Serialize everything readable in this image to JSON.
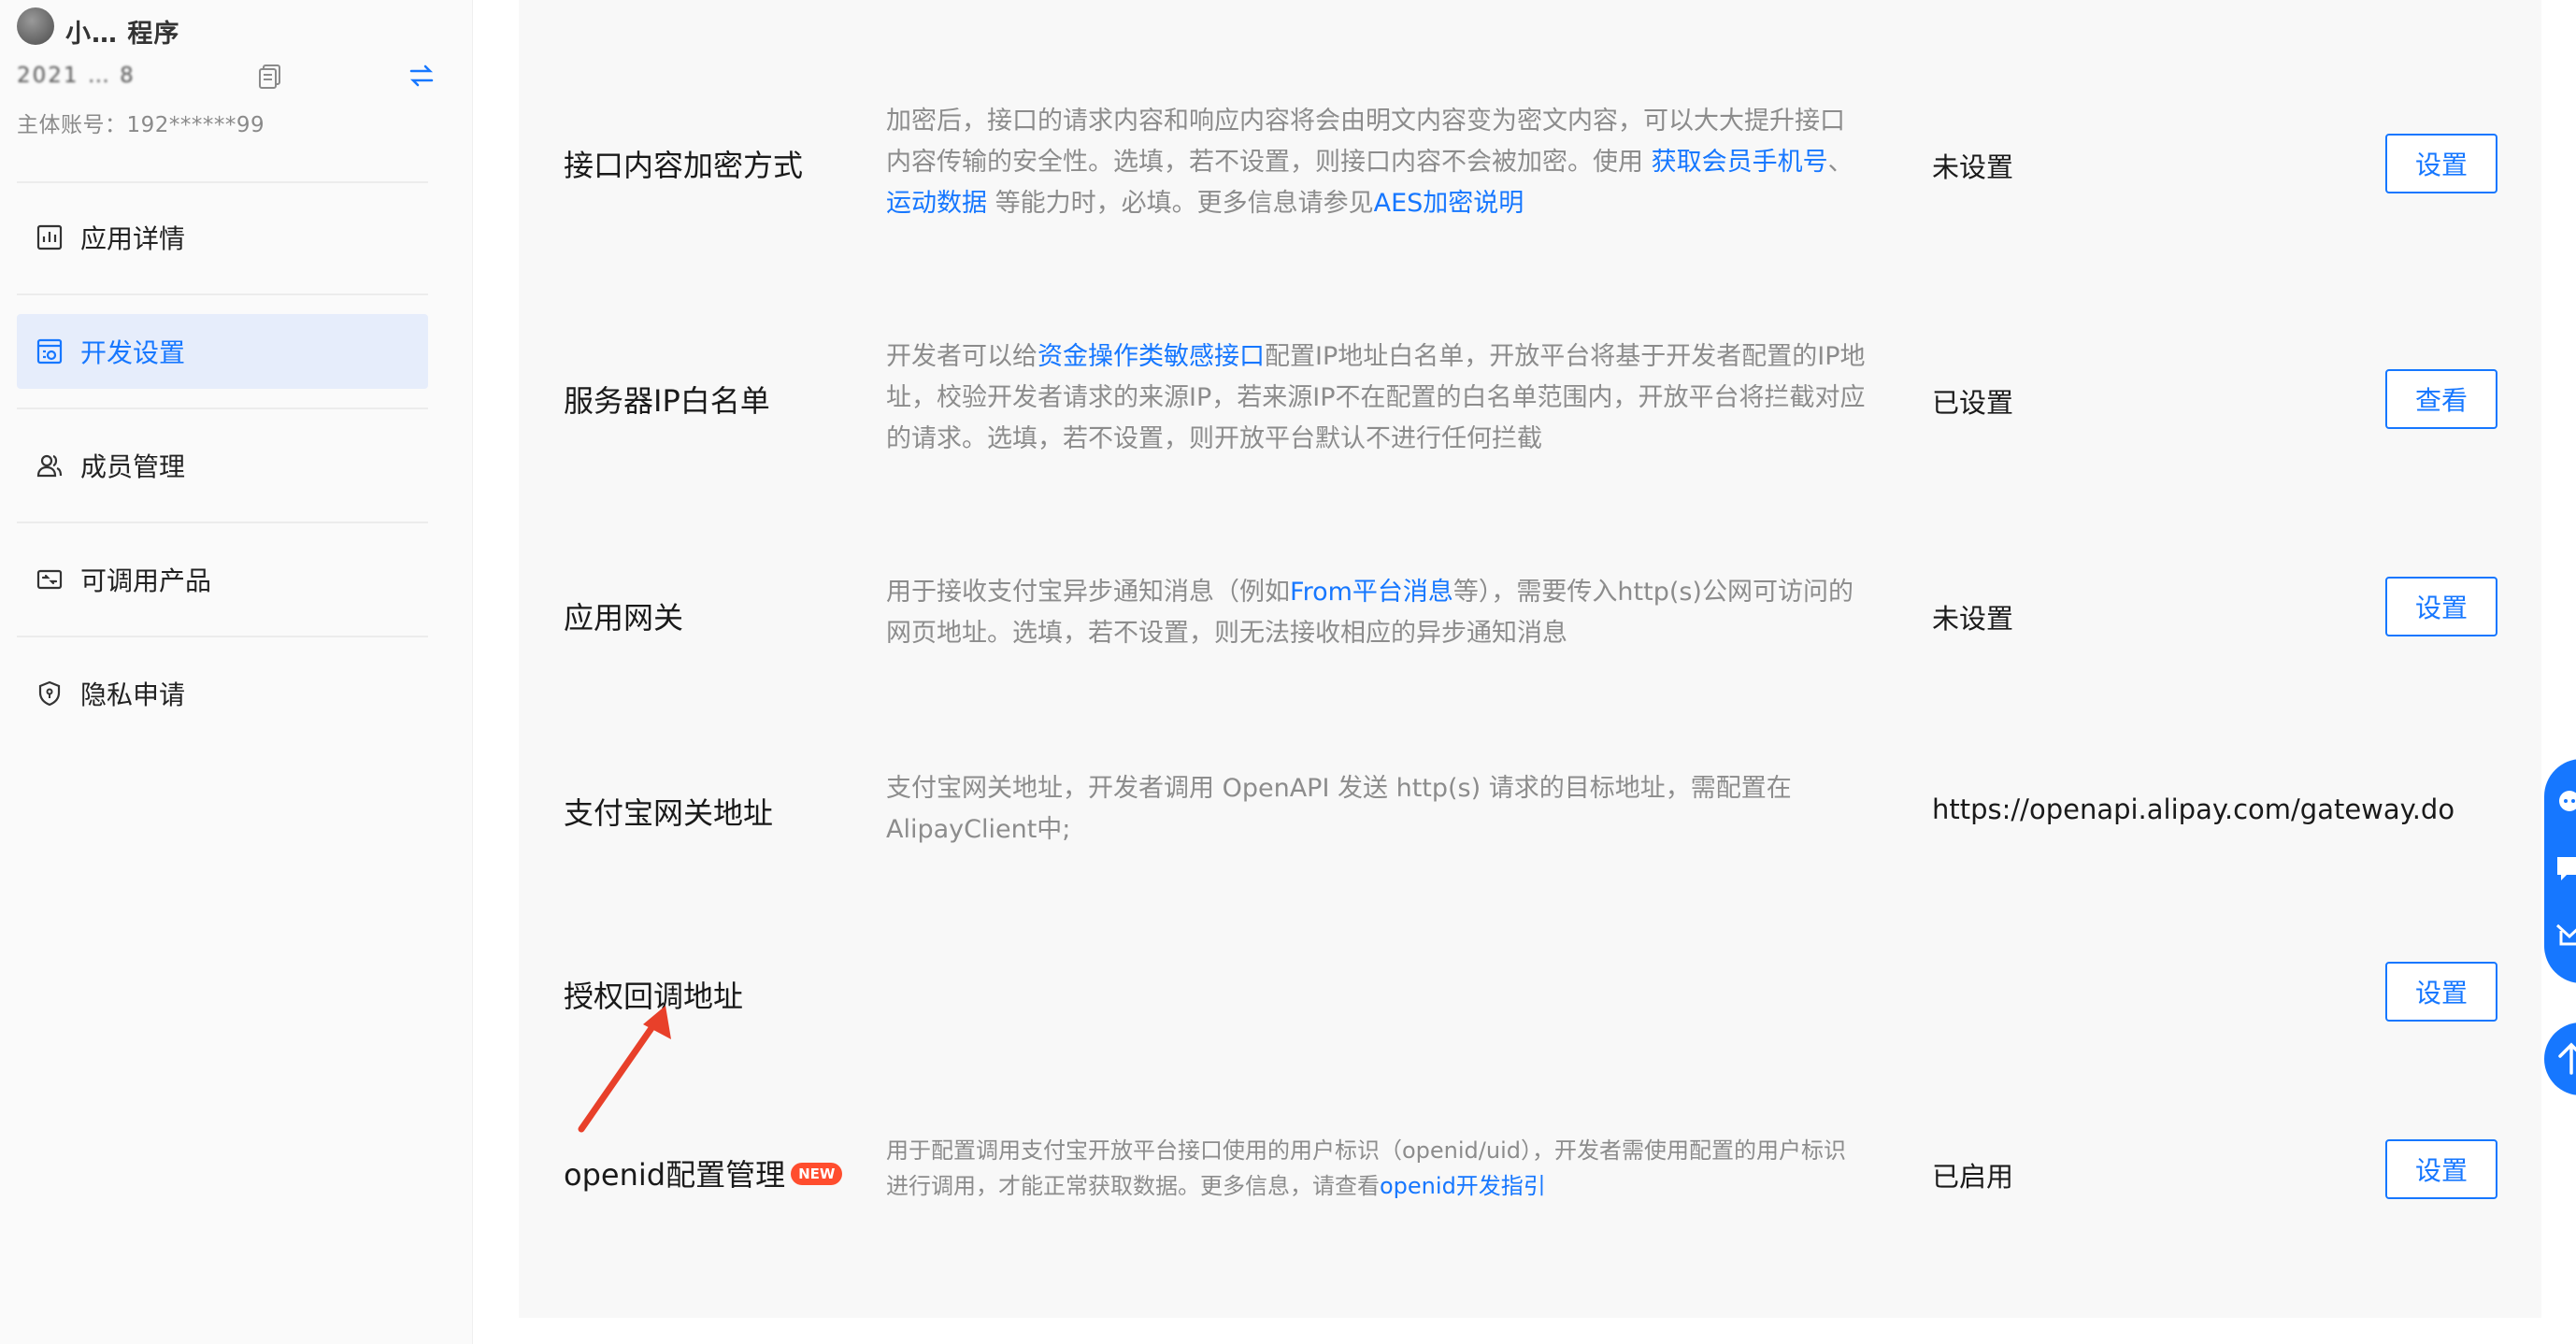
{
  "sidebar": {
    "app_name": "小… 程序",
    "app_id": "2021 … 8",
    "account_label": "主体账号：192******99",
    "nav": [
      {
        "label": "应用详情",
        "icon": "chart-icon",
        "active": false
      },
      {
        "label": "开发设置",
        "icon": "settings-doc-icon",
        "active": true
      },
      {
        "label": "成员管理",
        "icon": "members-icon",
        "active": false
      },
      {
        "label": "可调用产品",
        "icon": "product-icon",
        "active": false
      },
      {
        "label": "隐私申请",
        "icon": "shield-icon",
        "active": false
      }
    ]
  },
  "rows": {
    "encrypt": {
      "title": "接口内容加密方式",
      "desc_1": "加密后，接口的请求内容和响应内容将会由明文内容变为密文内容，可以大大提升接口内容传输的安全性。选填，若不设置，则接口内容不会被加密。使用 ",
      "link_1": "获取会员手机号",
      "desc_2": "、",
      "link_2": "运动数据",
      "desc_3": " 等能力时，必填。更多信息请参见",
      "link_3": "AES加密说明",
      "status": "未设置",
      "button": "设置"
    },
    "whitelist": {
      "title": "服务器IP白名单",
      "desc_1": "开发者可以给",
      "link_1": "资金操作类敏感接口",
      "desc_2": "配置IP地址白名单，开放平台将基于开发者配置的IP地址，校验开发者请求的来源IP，若来源IP不在配置的白名单范围内，开放平台将拦截对应的请求。选填，若不设置，则开放平台默认不进行任何拦截",
      "status": "已设置",
      "button": "查看"
    },
    "gateway": {
      "title": "应用网关",
      "desc_1": "用于接收支付宝异步通知消息（例如",
      "link_1": "From平台消息",
      "desc_2": "等），需要传入http(s)公网可访问的网页地址。选填，若不设置，则无法接收相应的异步通知消息",
      "status": "未设置",
      "button": "设置"
    },
    "alipay_gateway": {
      "title": "支付宝网关地址",
      "desc_1": "支付宝网关地址，开发者调用 OpenAPI 发送 http(s) 请求的目标地址，需配置在AlipayClient中;",
      "value": "https://openapi.alipay.com/gateway.do"
    },
    "callback": {
      "title": "授权回调地址",
      "button": "设置"
    },
    "openid": {
      "title": "openid配置管理",
      "badge": "NEW",
      "desc_1": "用于配置调用支付宝开放平台接口使用的用户标识（openid/uid），开发者需使用配置的用户标识进行调用，才能正常获取数据。更多信息，请查看",
      "link_1": "openid开发指引",
      "status": "已启用",
      "button": "设置"
    }
  },
  "colors": {
    "accent": "#1677ff",
    "badge": "#ff4d2e",
    "annotation_arrow": "#e8402a",
    "panel_bg": "#f8f8f8"
  }
}
